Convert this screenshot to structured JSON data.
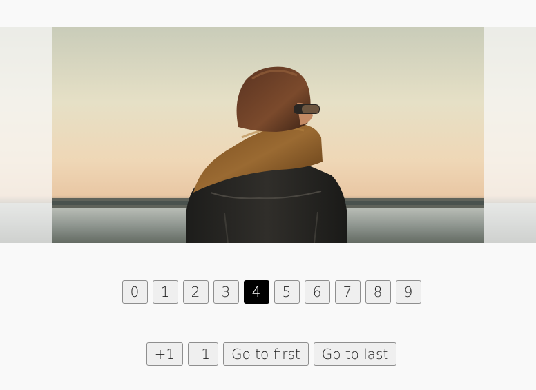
{
  "carousel": {
    "current_index": 4,
    "slide_image": "person-in-scarf-facing-sea-photo"
  },
  "pager": {
    "pages": [
      "0",
      "1",
      "2",
      "3",
      "4",
      "5",
      "6",
      "7",
      "8",
      "9"
    ],
    "active": "4"
  },
  "controls": {
    "plus_one": "+1",
    "minus_one": "-1",
    "go_first": "Go to first",
    "go_last": "Go to last"
  },
  "colors": {
    "page_background": "#f9f9f9",
    "button_background": "#efefef",
    "active_button_background": "#000000",
    "active_button_text": "#ffffff"
  }
}
